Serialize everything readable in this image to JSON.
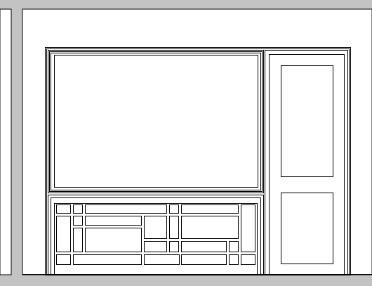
{
  "colors": {
    "frame": "#c3c3c3",
    "background": "#ffffff",
    "line": "#000000"
  },
  "drawing": {
    "type": "elevation drawing",
    "elements": [
      "upper-window",
      "lower-grille-panel",
      "door",
      "door-upper-panel",
      "door-lower-panel"
    ]
  }
}
